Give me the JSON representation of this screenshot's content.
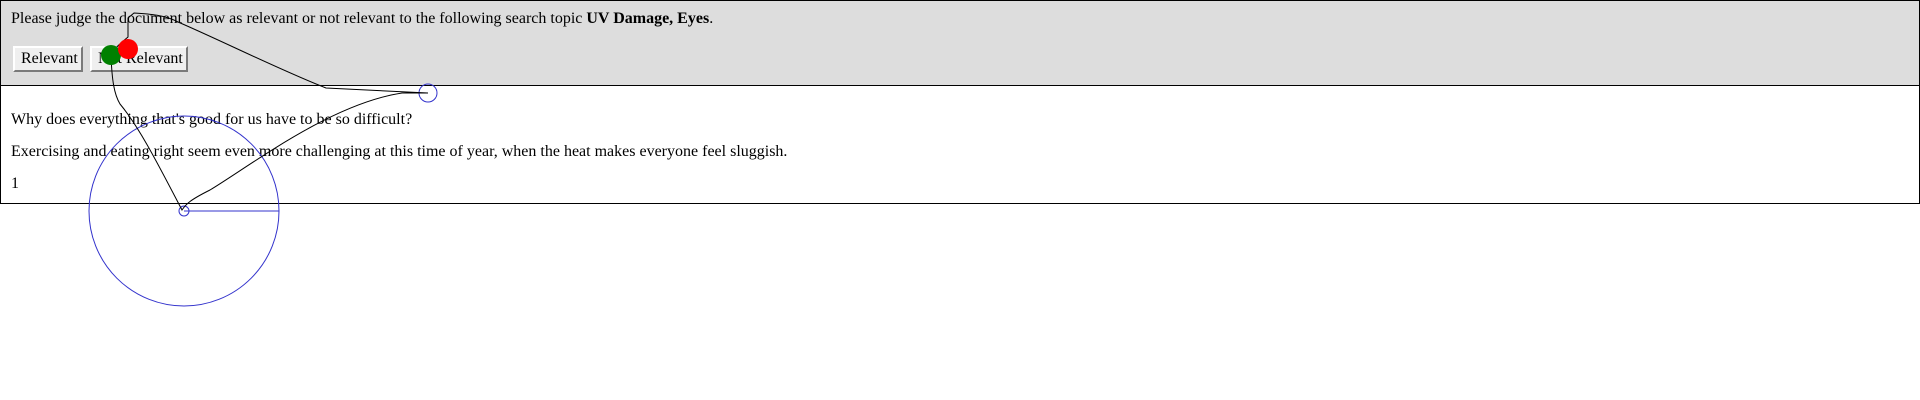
{
  "topic_panel": {
    "instruction_prefix": "Please judge the document below as relevant or not relevant to the following search topic",
    "topic": "UV Damage, Eyes",
    "instruction_suffix": ".",
    "relevant_label": "Relevant",
    "not_relevant_label": "Not Relevant"
  },
  "document": {
    "title": "Why does everything that's good for us have to be so difficult?",
    "body": "Exercising and eating right seem even more challenging at this time of year, when the heat makes everyone feel sluggish.",
    "rank": "1"
  },
  "overlay": {
    "start_marker_color": "#008000",
    "end_marker_color": "#ff0000",
    "path_color": "#000000",
    "target_color": "#3333cc"
  }
}
